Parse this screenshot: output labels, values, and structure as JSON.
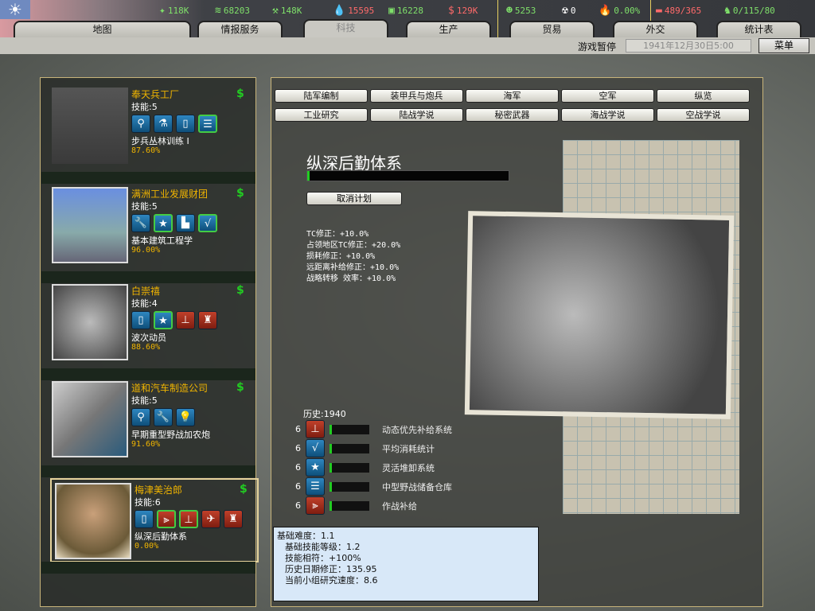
{
  "topbar": {
    "resources": [
      {
        "icon": "energy-icon",
        "value": "118K",
        "color": "#7fe06a"
      },
      {
        "icon": "metal-icon",
        "value": "68203",
        "color": "#7fe06a"
      },
      {
        "icon": "rare-materials-icon",
        "value": "148K",
        "color": "#7fe06a"
      },
      {
        "icon": "oil-icon",
        "value": "15595",
        "color": "#ff6a6a"
      },
      {
        "icon": "supplies-icon",
        "value": "16228",
        "color": "#7fe06a"
      },
      {
        "icon": "money-icon",
        "value": "129K",
        "color": "#ff6a6a"
      },
      {
        "icon": "manpower-icon",
        "value": "5253",
        "color": "#7fe06a"
      },
      {
        "icon": "nuclear-icon",
        "value": "0",
        "color": "#ffffff"
      },
      {
        "icon": "dissent-icon",
        "value": "0.00%",
        "color": "#7fe06a"
      },
      {
        "icon": "transport-icon",
        "value": "489/365",
        "color": "#ff6a6a"
      },
      {
        "icon": "convoy-icon",
        "value": "0/115/80",
        "color": "#7fe06a"
      }
    ],
    "tabs": [
      "地图",
      "情报服务",
      "科技",
      "生产",
      "贸易",
      "外交",
      "统计表"
    ],
    "active_tab": "科技",
    "status": "游戏暂停",
    "date": "1941年12月30日5:00",
    "menu": "菜单"
  },
  "teams": [
    {
      "name": "奉天兵工厂",
      "skill": "技能:5",
      "project": "步兵丛林训练 I",
      "progress": "87.60%",
      "icons": [
        {
          "n": "artillery-icon",
          "c": "blue",
          "g": "⚲"
        },
        {
          "n": "chemistry-icon",
          "c": "blue",
          "g": "⚗"
        },
        {
          "n": "book-icon",
          "c": "blue",
          "g": "▯"
        },
        {
          "n": "logistics-icon",
          "c": "blue",
          "g": "☰",
          "h": true
        }
      ]
    },
    {
      "name": "满洲工业发展财团",
      "skill": "技能:5",
      "project": "基本建筑工程学",
      "progress": "96.00%",
      "icons": [
        {
          "n": "wrench-icon",
          "c": "blue",
          "g": "🔧"
        },
        {
          "n": "star-icon",
          "c": "blue",
          "g": "★",
          "h": true
        },
        {
          "n": "factory-icon",
          "c": "blue",
          "g": "▙"
        },
        {
          "n": "math-icon",
          "c": "blue",
          "g": "√",
          "h": true
        }
      ]
    },
    {
      "name": "白崇禧",
      "skill": "技能:4",
      "project": "波次动员",
      "progress": "88.60%",
      "icons": [
        {
          "n": "book-icon",
          "c": "blue",
          "g": "▯"
        },
        {
          "n": "star-icon",
          "c": "blue",
          "g": "★",
          "h": true
        },
        {
          "n": "organization-icon",
          "c": "red",
          "g": "⊥"
        },
        {
          "n": "infantry-icon",
          "c": "red",
          "g": "♜"
        }
      ]
    },
    {
      "name": "道和汽车制造公司",
      "skill": "技能:5",
      "project": "早期重型野战加农炮",
      "progress": "91.60%",
      "icons": [
        {
          "n": "artillery-icon",
          "c": "blue",
          "g": "⚲"
        },
        {
          "n": "wrench-icon",
          "c": "blue",
          "g": "🔧"
        },
        {
          "n": "lightbulb-icon",
          "c": "blue",
          "g": "💡"
        }
      ]
    },
    {
      "name": "梅津美治郎",
      "skill": "技能:6",
      "project": "纵深后勤体系",
      "progress": "0.00%",
      "icons": [
        {
          "n": "book-icon",
          "c": "blue",
          "g": "▯"
        },
        {
          "n": "supply-icon",
          "c": "red",
          "g": "⫸",
          "h": true
        },
        {
          "n": "organization-icon",
          "c": "red",
          "g": "⊥",
          "h": true
        },
        {
          "n": "air-icon",
          "c": "red",
          "g": "✈"
        },
        {
          "n": "infantry-icon",
          "c": "red",
          "g": "♜"
        }
      ]
    }
  ],
  "categories": {
    "row1": [
      "陆军编制",
      "装甲兵与炮兵",
      "海军",
      "空军",
      "纵览"
    ],
    "row2": [
      "工业研究",
      "陆战学说",
      "秘密武器",
      "海战学说",
      "空战学说"
    ]
  },
  "tech": {
    "title": "纵深后勤体系",
    "progress_pct": 0,
    "cancel": "取消计划",
    "modifiers": [
      "TC修正：+10.0%",
      "占领地区TC修正：+20.0%",
      "损耗修正：+10.0%",
      "远距离补给修正：+10.0%",
      "战略转移 效率：+10.0%"
    ],
    "history": "历史:1940",
    "components": [
      {
        "level": "6",
        "icon": "organization-icon",
        "c": "red",
        "g": "⊥",
        "name": "动态优先补给系统"
      },
      {
        "level": "6",
        "icon": "math-icon",
        "c": "blue",
        "g": "√",
        "name": "平均消耗统计"
      },
      {
        "level": "6",
        "icon": "star-icon",
        "c": "blue",
        "g": "★",
        "name": "灵活堆卸系统"
      },
      {
        "level": "6",
        "icon": "logistics-icon",
        "c": "blue",
        "g": "☰",
        "name": "中型野战储备仓库"
      },
      {
        "level": "6",
        "icon": "supply-icon",
        "c": "red",
        "g": "⫸",
        "name": "作战补给"
      }
    ]
  },
  "info": [
    "基础难度：1.1",
    "基础技能等级：1.2",
    "技能相符：+100%",
    "历史日期修正：135.95",
    "当前小组研究速度：8.6"
  ]
}
